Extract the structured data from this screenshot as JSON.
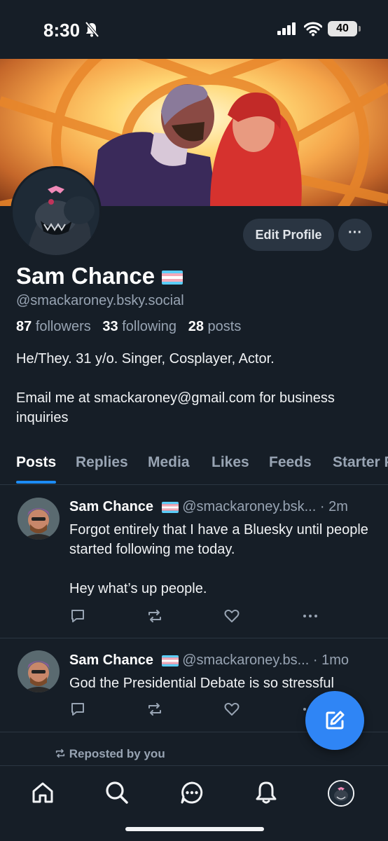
{
  "status_bar": {
    "time": "8:30",
    "battery": "40"
  },
  "profile": {
    "display_name": "Sam Chance",
    "handle": "@smackaroney.bsky.social",
    "followers_count": "87",
    "followers_label": "followers",
    "following_count": "33",
    "following_label": "following",
    "posts_count": "28",
    "posts_label": "posts",
    "bio_line1": "He/They. 31 y/o. Singer, Cosplayer, Actor.",
    "bio_line2": "Email me at smackaroney@gmail.com for business inquiries",
    "edit_profile_label": "Edit Profile",
    "more_label": "···"
  },
  "tabs": [
    {
      "label": "Posts"
    },
    {
      "label": "Replies"
    },
    {
      "label": "Media"
    },
    {
      "label": "Likes"
    },
    {
      "label": "Feeds"
    },
    {
      "label": "Starter Packs"
    }
  ],
  "posts": [
    {
      "name": "Sam Chance",
      "handle": "@smackaroney.bsk...",
      "time": "· 2m",
      "text_p1": "Forgot entirely that I have a Bluesky until people started following me today.",
      "text_p2": "Hey what’s up people."
    },
    {
      "name": "Sam Chance",
      "handle": "@smackaroney.bs...",
      "time": "· 1mo",
      "text_p1": "God the Presidential Debate is so stressful"
    }
  ],
  "repost_label": "Reposted by you",
  "icons": {
    "reply": "reply-icon",
    "repost": "repost-icon",
    "like": "like-icon",
    "more": "more-icon",
    "compose": "compose-icon",
    "home": "home-icon",
    "search": "search-icon",
    "chat": "chat-icon",
    "notifications": "bell-icon"
  },
  "colors": {
    "background": "#161e27",
    "accent": "#1d8cf5",
    "fab": "#2f85f5",
    "muted_text": "#98a4b3",
    "button_bg": "#2a3542"
  }
}
